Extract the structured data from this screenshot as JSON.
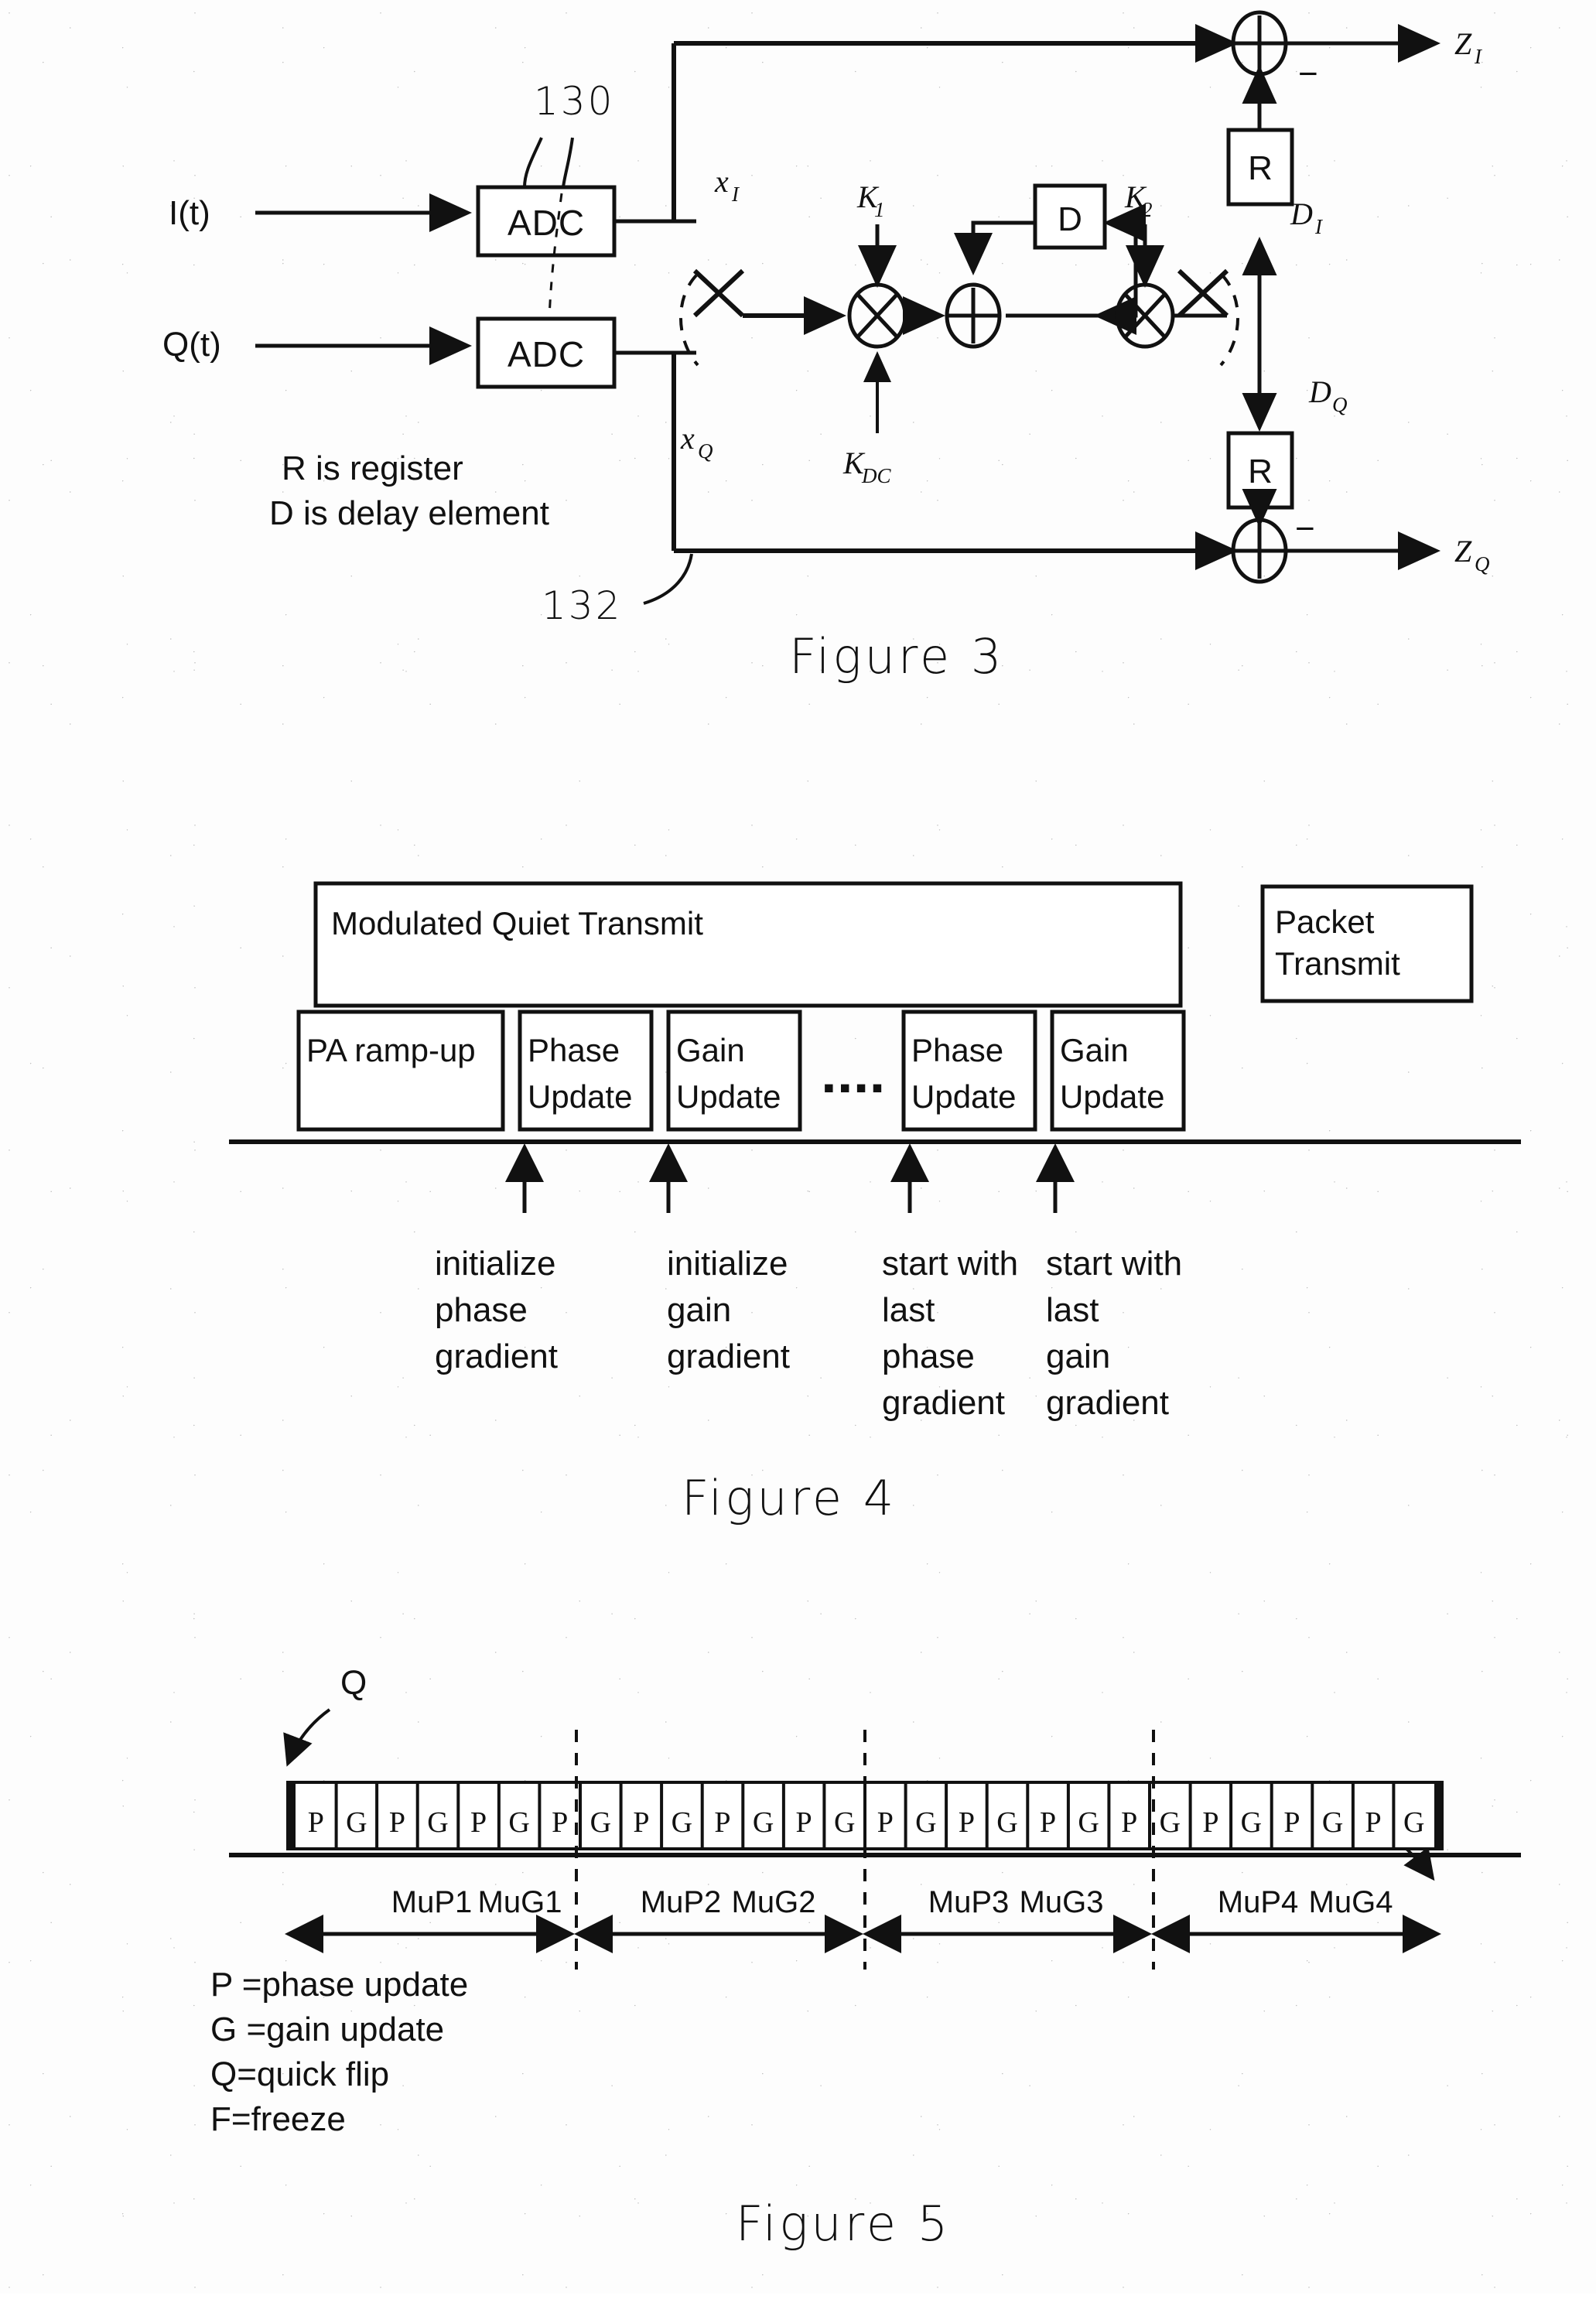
{
  "sheet": {
    "figures": [
      "Figure 3",
      "Figure 4",
      "Figure 5"
    ]
  },
  "figure3": {
    "caption": "Figure 3",
    "ref_numerals": {
      "adc_pair": "130",
      "feedback_path": "132"
    },
    "inputs": [
      {
        "label": "I(t)"
      },
      {
        "label": "Q(t)"
      }
    ],
    "blocks": [
      {
        "name": "adc-i",
        "label": "ADC"
      },
      {
        "name": "adc-q",
        "label": "ADC"
      },
      {
        "name": "delay",
        "label": "D"
      },
      {
        "name": "register-i",
        "label": "R"
      },
      {
        "name": "register-q",
        "label": "R"
      }
    ],
    "signals": {
      "x_i": "x",
      "x_i_sub": "I",
      "x_q": "x",
      "x_q_sub": "Q",
      "z_i": "Z",
      "z_i_sub": "I",
      "z_q": "Z",
      "z_q_sub": "Q",
      "d_i": "D",
      "d_i_sub": "I",
      "d_q": "D",
      "d_q_sub": "Q"
    },
    "coefficients": [
      {
        "base": "K",
        "sub": "1"
      },
      {
        "base": "K",
        "sub": "2"
      },
      {
        "base": "K",
        "sub": "DC"
      }
    ],
    "sign_markers": [
      "−",
      "−"
    ],
    "legend": [
      "R is register",
      "D is delay element"
    ]
  },
  "figure4": {
    "caption": "Figure 4",
    "phases": [
      {
        "label": "Modulated Quiet Transmit"
      },
      {
        "label": "Packet\nTransmit",
        "line1": "Packet",
        "line2": "Transmit"
      }
    ],
    "slots": [
      {
        "line1": "PA ramp-up",
        "line2": ""
      },
      {
        "line1": "Phase",
        "line2": "Update"
      },
      {
        "line1": "Gain",
        "line2": "Update"
      },
      {
        "line1": "Phase",
        "line2": "Update"
      },
      {
        "line1": "Gain",
        "line2": "Update"
      }
    ],
    "ellipsis": "▪▪▪▪",
    "annotations": [
      {
        "lines": [
          "initialize",
          "phase",
          "gradient"
        ]
      },
      {
        "lines": [
          "initialize",
          "gain",
          "gradient"
        ]
      },
      {
        "lines": [
          "start with",
          "last",
          "phase",
          "gradient"
        ]
      },
      {
        "lines": [
          "start with",
          "last",
          "gain",
          "gradient"
        ]
      }
    ]
  },
  "figure5": {
    "caption": "Figure 5",
    "markers": [
      {
        "label": "Q",
        "name": "quick-flip-marker"
      },
      {
        "label": "F",
        "name": "freeze-marker"
      }
    ],
    "cells": [
      "P",
      "G",
      "P",
      "G",
      "P",
      "G",
      "P",
      "G",
      "P",
      "G",
      "P",
      "G",
      "P",
      "G",
      "P",
      "G",
      "P",
      "G",
      "P",
      "G",
      "P",
      "G",
      "P",
      "G",
      "P",
      "G",
      "P",
      "G"
    ],
    "segments": [
      {
        "left": "MuP1",
        "right": "MuG1"
      },
      {
        "left": "MuP2",
        "right": "MuG2"
      },
      {
        "left": "MuP3",
        "right": "MuG3"
      },
      {
        "left": "MuP4",
        "right": "MuG4"
      }
    ],
    "legend": [
      "P =phase update",
      "G =gain update",
      "Q=quick flip",
      "F=freeze"
    ]
  }
}
